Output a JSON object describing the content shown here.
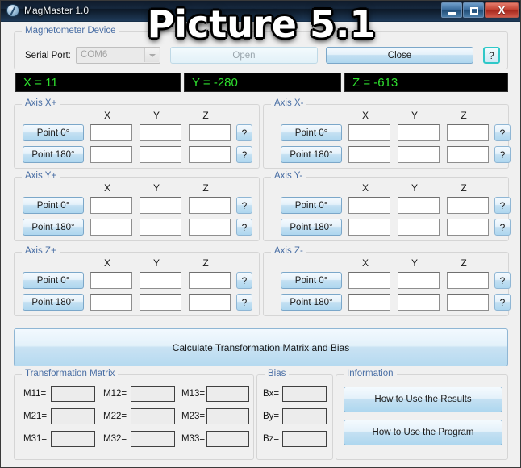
{
  "window": {
    "title": "MagMaster 1.0",
    "icon": "compass-icon",
    "minimize_label": "",
    "maximize_label": "",
    "close_label": "X"
  },
  "watermark": {
    "text": "Picture 5.1"
  },
  "device": {
    "group_label": "Magnetometer Device",
    "serial_port_label": "Serial Port:",
    "serial_port_value": "COM6",
    "open_label": "Open",
    "close_label": "Close",
    "help_label": "?"
  },
  "readouts": [
    {
      "name": "x-readout",
      "text": "X = 11"
    },
    {
      "name": "y-readout",
      "text": "Y = -280"
    },
    {
      "name": "z-readout",
      "text": "Z = -613"
    }
  ],
  "axis_columns": [
    "X",
    "Y",
    "Z"
  ],
  "axis_groups": [
    {
      "id": "axis-x-plus",
      "label": "Axis X+",
      "rows": [
        {
          "button": "Point 0°",
          "values": [
            "",
            "",
            ""
          ],
          "help": "?"
        },
        {
          "button": "Point 180°",
          "values": [
            "",
            "",
            ""
          ],
          "help": "?"
        }
      ]
    },
    {
      "id": "axis-x-minus",
      "label": "Axis X-",
      "rows": [
        {
          "button": "Point 0°",
          "values": [
            "",
            "",
            ""
          ],
          "help": "?"
        },
        {
          "button": "Point 180°",
          "values": [
            "",
            "",
            ""
          ],
          "help": "?"
        }
      ]
    },
    {
      "id": "axis-y-plus",
      "label": "Axis Y+",
      "rows": [
        {
          "button": "Point 0°",
          "values": [
            "",
            "",
            ""
          ],
          "help": "?"
        },
        {
          "button": "Point 180°",
          "values": [
            "",
            "",
            ""
          ],
          "help": "?"
        }
      ]
    },
    {
      "id": "axis-y-minus",
      "label": "Axis Y-",
      "rows": [
        {
          "button": "Point 0°",
          "values": [
            "",
            "",
            ""
          ],
          "help": "?"
        },
        {
          "button": "Point 180°",
          "values": [
            "",
            "",
            ""
          ],
          "help": "?"
        }
      ]
    },
    {
      "id": "axis-z-plus",
      "label": "Axis Z+",
      "rows": [
        {
          "button": "Point 0°",
          "values": [
            "",
            "",
            ""
          ],
          "help": "?"
        },
        {
          "button": "Point 180°",
          "values": [
            "",
            "",
            ""
          ],
          "help": "?"
        }
      ]
    },
    {
      "id": "axis-z-minus",
      "label": "Axis Z-",
      "rows": [
        {
          "button": "Point 0°",
          "values": [
            "",
            "",
            ""
          ],
          "help": "?"
        },
        {
          "button": "Point 180°",
          "values": [
            "",
            "",
            ""
          ],
          "help": "?"
        }
      ]
    }
  ],
  "calculate": {
    "label": "Calculate Transformation Matrix and Bias"
  },
  "matrix": {
    "group_label": "Transformation Matrix",
    "cells": [
      {
        "label": "M11=",
        "value": ""
      },
      {
        "label": "M12=",
        "value": ""
      },
      {
        "label": "M13=",
        "value": ""
      },
      {
        "label": "M21=",
        "value": ""
      },
      {
        "label": "M22=",
        "value": ""
      },
      {
        "label": "M23=",
        "value": ""
      },
      {
        "label": "M31=",
        "value": ""
      },
      {
        "label": "M32=",
        "value": ""
      },
      {
        "label": "M33=",
        "value": ""
      }
    ]
  },
  "bias": {
    "group_label": "Bias",
    "cells": [
      {
        "label": "Bx=",
        "value": ""
      },
      {
        "label": "By=",
        "value": ""
      },
      {
        "label": "Bz=",
        "value": ""
      }
    ]
  },
  "information": {
    "group_label": "Information",
    "buttons": [
      {
        "label": "How to Use the Results"
      },
      {
        "label": "How to Use the Program"
      }
    ]
  },
  "colors": {
    "readout_text": "#2ee02e",
    "readout_bg": "#000000",
    "group_label": "#4a6fa5",
    "accent_focus": "#2fc8c8",
    "window_bg": "#f0f0f0"
  }
}
